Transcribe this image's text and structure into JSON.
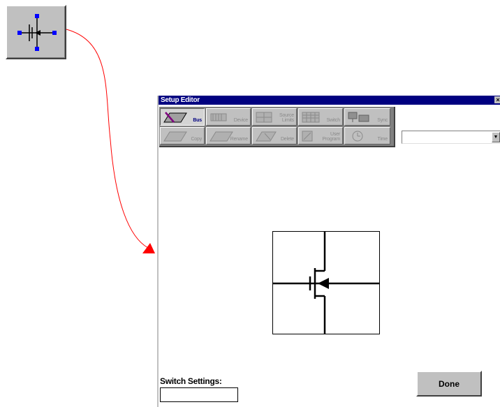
{
  "window": {
    "title": "Setup Editor",
    "close_glyph": "×"
  },
  "toolbar": {
    "buttons": [
      {
        "label": "Bus",
        "icon": "bus-icon",
        "active": true
      },
      {
        "label": "Device",
        "icon": "device-icon",
        "active": false
      },
      {
        "label": "Source Limits",
        "icon": "source-icon",
        "active": false
      },
      {
        "label": "Switch",
        "icon": "switch-icon",
        "active": false
      },
      {
        "label": "Sync",
        "icon": "sync-icon",
        "active": false
      },
      {
        "label": "Copy",
        "icon": "copy-icon",
        "active": false
      },
      {
        "label": "Rename",
        "icon": "rename-icon",
        "active": false
      },
      {
        "label": "Delete",
        "icon": "delete-icon",
        "active": false
      },
      {
        "label": "User Program",
        "icon": "user-program-icon",
        "active": false
      },
      {
        "label": "Time",
        "icon": "time-icon",
        "active": false
      }
    ]
  },
  "dropdown": {
    "value": "",
    "arrow": "▼"
  },
  "switch_settings": {
    "label": "Switch Settings:",
    "value": ""
  },
  "done": {
    "label": "Done"
  },
  "colors": {
    "titlebar": "#000080",
    "arrow": "#ff0000",
    "handles": "#0000ff"
  }
}
